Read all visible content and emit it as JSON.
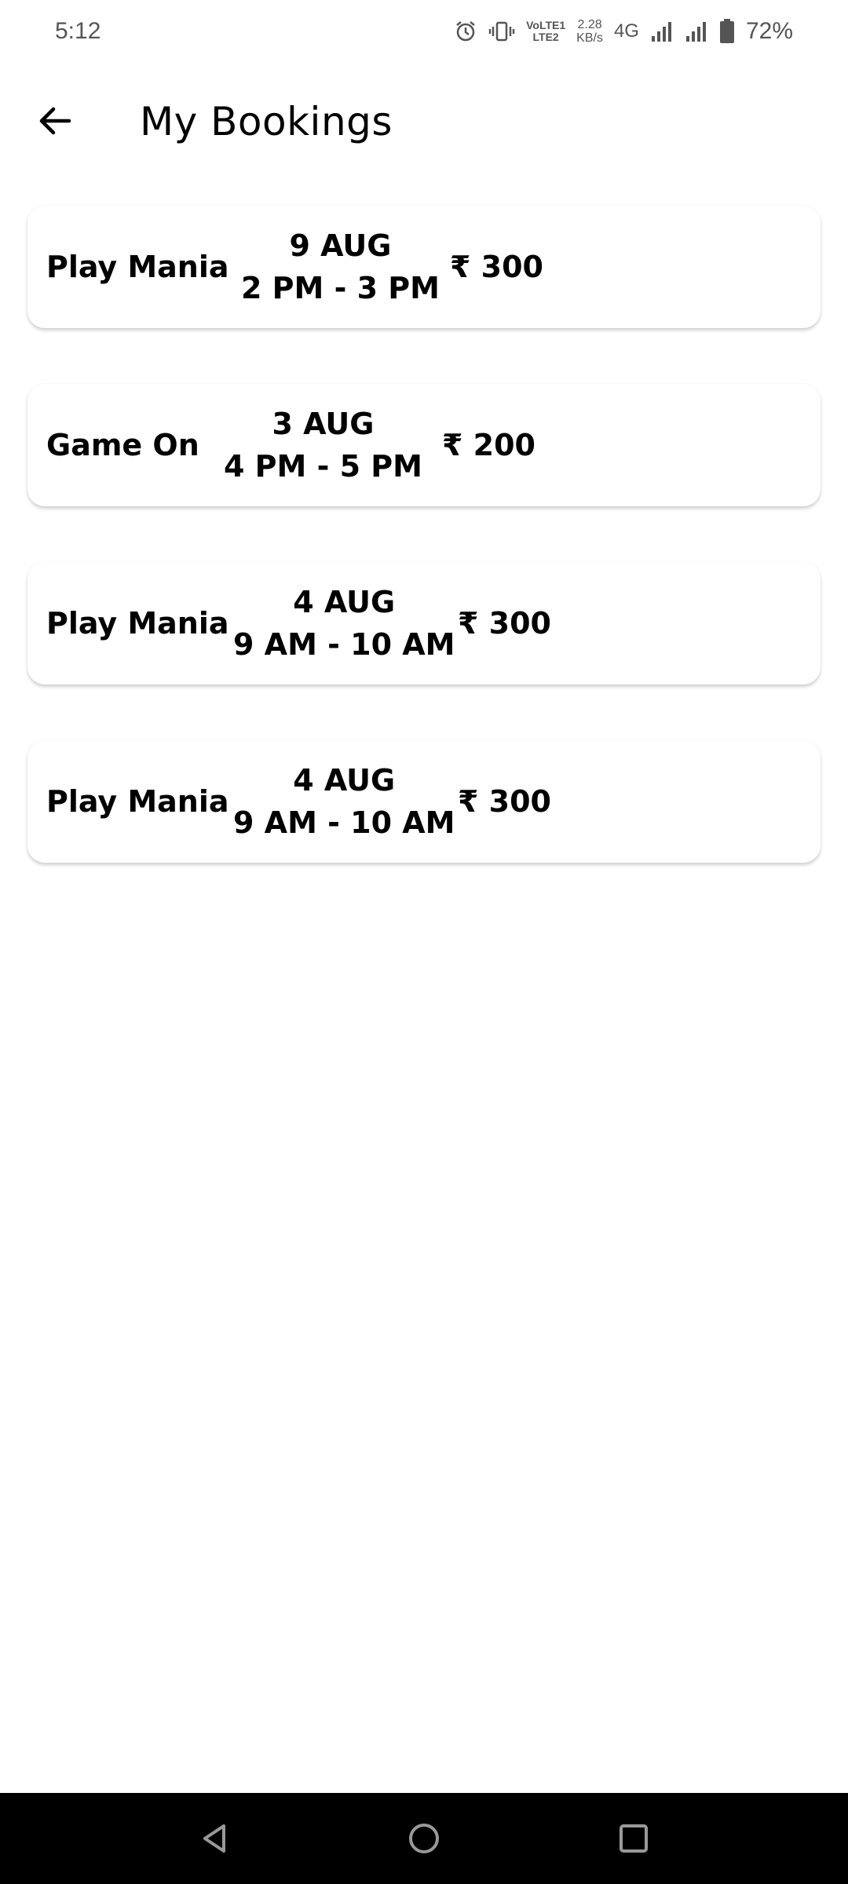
{
  "status_bar": {
    "time": "5:12",
    "volte_line1": "VoLTE1",
    "volte_line2": "LTE2",
    "speed_value": "2.28",
    "speed_unit": "KB/s",
    "network_type": "4G",
    "battery_percent": "72%"
  },
  "header": {
    "title": "My Bookings"
  },
  "bookings": [
    {
      "venue": "Play Mania",
      "date": "9 AUG",
      "time": "2 PM - 3 PM",
      "price": "₹ 300"
    },
    {
      "venue": "Game On",
      "date": "3 AUG",
      "time": "4 PM - 5 PM",
      "price": "₹ 200"
    },
    {
      "venue": "Play Mania",
      "date": "4 AUG",
      "time": "9 AM - 10 AM",
      "price": "₹ 300"
    },
    {
      "venue": "Play Mania",
      "date": "4 AUG",
      "time": "9 AM - 10 AM",
      "price": "₹ 300"
    }
  ],
  "icons": {
    "back": "arrow-left-icon",
    "alarm": "alarm-icon",
    "vibrate": "vibrate-icon",
    "signal": "signal-icon",
    "battery": "battery-icon",
    "nav_back": "triangle-back-icon",
    "nav_home": "circle-home-icon",
    "nav_recents": "square-recents-icon"
  },
  "colors": {
    "background": "#ffffff",
    "text": "#000000",
    "status_text": "#555555",
    "nav_bar": "#000000"
  }
}
